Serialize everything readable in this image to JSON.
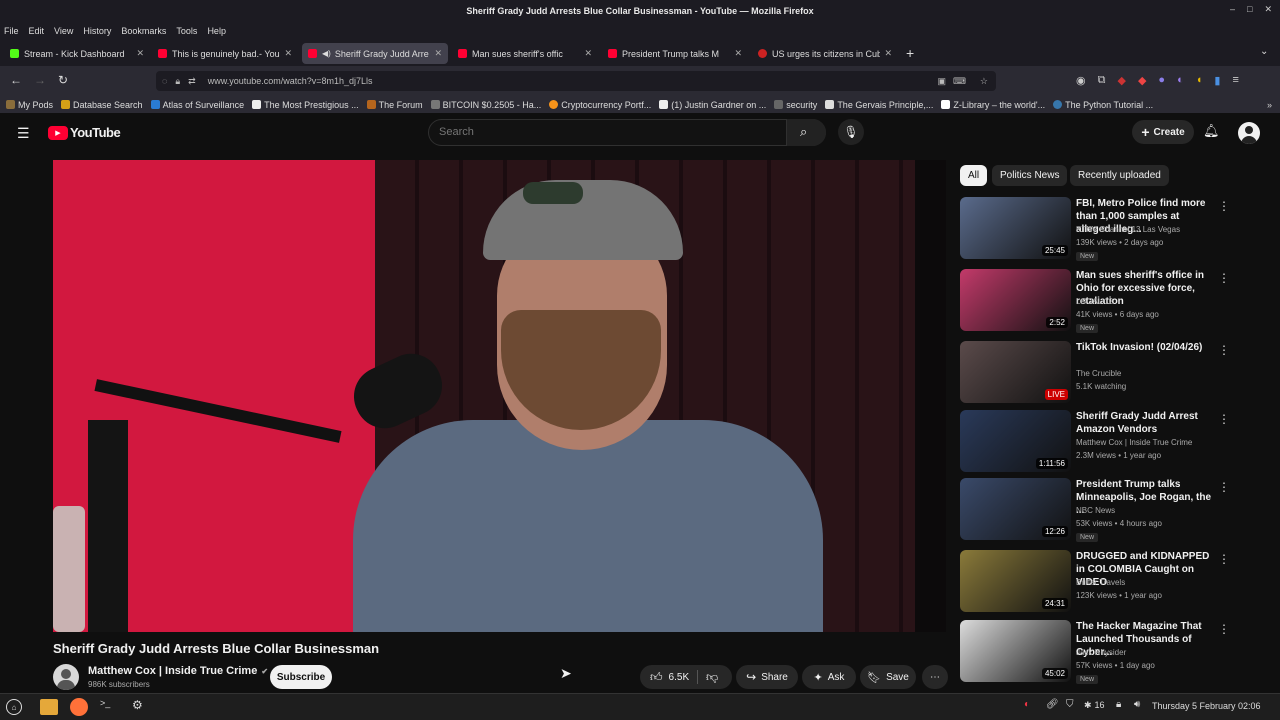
{
  "window": {
    "title": "Sheriff Grady Judd Arrests Blue Collar Businessman - YouTube — Mozilla Firefox"
  },
  "menu": [
    "File",
    "Edit",
    "View",
    "History",
    "Bookmarks",
    "Tools",
    "Help"
  ],
  "tabs": [
    {
      "label": "Stream - Kick Dashboard",
      "color": "#53fc18"
    },
    {
      "label": "This is genuinely bad.- You",
      "color": "#ff0033"
    },
    {
      "label": "Sheriff Grady Judd Arre",
      "color": "#ff0033"
    },
    {
      "label": "Man sues sheriff's offic",
      "color": "#ff0033"
    },
    {
      "label": "President Trump talks M",
      "color": "#ff0033"
    },
    {
      "label": "US urges its citizens in Cuba",
      "color": "#cc2222"
    }
  ],
  "url": "www.youtube.com/watch?v=8m1h_dj7Lls",
  "bookmarks": [
    {
      "label": "My Pods",
      "color": "#8a6d3b"
    },
    {
      "label": "Database Search",
      "color": "#d4a017"
    },
    {
      "label": "Atlas of Surveillance",
      "color": "#2a7bd3"
    },
    {
      "label": "The Most Prestigious ...",
      "color": "#222"
    },
    {
      "label": "The Forum",
      "color": "#b5651d"
    },
    {
      "label": "BITCOIN $0.2505 - Ha...",
      "color": "#444"
    },
    {
      "label": "Cryptocurrency Portf...",
      "color": "#f7931a"
    },
    {
      "label": "(1) Justin Gardner on ...",
      "color": "#000"
    },
    {
      "label": "security",
      "color": "#666"
    },
    {
      "label": "The Gervais Principle,...",
      "color": "#ddd"
    },
    {
      "label": "Z-Library – the world'...",
      "color": "#fff"
    },
    {
      "label": "The Python Tutorial ...",
      "color": "#3776ab"
    }
  ],
  "youtube": {
    "logo": "YouTube",
    "search_placeholder": "Search",
    "create_label": "Create"
  },
  "chips": [
    "All",
    "Politics News",
    "Recently uploaded"
  ],
  "video": {
    "title": "Sheriff Grady Judd Arrests Blue Collar Businessman",
    "channel": "Matthew Cox | Inside True Crime",
    "subscribers": "986K subscribers",
    "subscribe_label": "Subscribe",
    "likes": "6.5K",
    "share_label": "Share",
    "ask_label": "Ask",
    "save_label": "Save"
  },
  "recommendations": [
    {
      "title": "FBI, Metro Police find more than 1,000 samples at alleged illeg...",
      "channel": "KTNV Channel 13 Las Vegas",
      "meta": "139K views • 2 days ago",
      "duration": "25:45",
      "new": "New",
      "thumb": "#5a6b8c"
    },
    {
      "title": "Man sues sheriff's office in Ohio for excessive force, retaliation",
      "channel": "LOCAL 12",
      "meta": "41K views • 6 days ago",
      "duration": "2:52",
      "new": "New",
      "thumb": "#c33a6a"
    },
    {
      "title": "TikTok Invasion! (02/04/26)",
      "channel": "The Crucible",
      "meta": "5.1K watching",
      "duration": "LIVE",
      "new": "",
      "thumb": "#5b4b4b"
    },
    {
      "title": "Sheriff Grady Judd Arrest Amazon Vendors",
      "channel": "Matthew Cox | Inside True Crime",
      "meta": "2.3M views • 1 year ago",
      "duration": "1:11:56",
      "new": "",
      "thumb": "#2a3a5a"
    },
    {
      "title": "President Trump talks Minneapolis, Joe Rogan, the ...",
      "channel": "NBC News",
      "meta": "53K views • 4 hours ago",
      "duration": "12:26",
      "new": "New",
      "thumb": "#3a4a6a"
    },
    {
      "title": "DRUGGED and KIDNAPPED in COLOMBIA Caught on VIDEO",
      "channel": "Buffer Travels",
      "meta": "123K views • 1 year ago",
      "duration": "24:31",
      "new": "",
      "thumb": "#8a7a3a"
    },
    {
      "title": "The Hacker Magazine That Launched Thousands of Cyber...",
      "channel": "Jack Rhysider",
      "meta": "57K views • 1 day ago",
      "duration": "45:02",
      "new": "New",
      "thumb": "#dcdcdc"
    }
  ],
  "taskbar": {
    "date": "Thursday 5 February 02:06",
    "volume": "16"
  }
}
